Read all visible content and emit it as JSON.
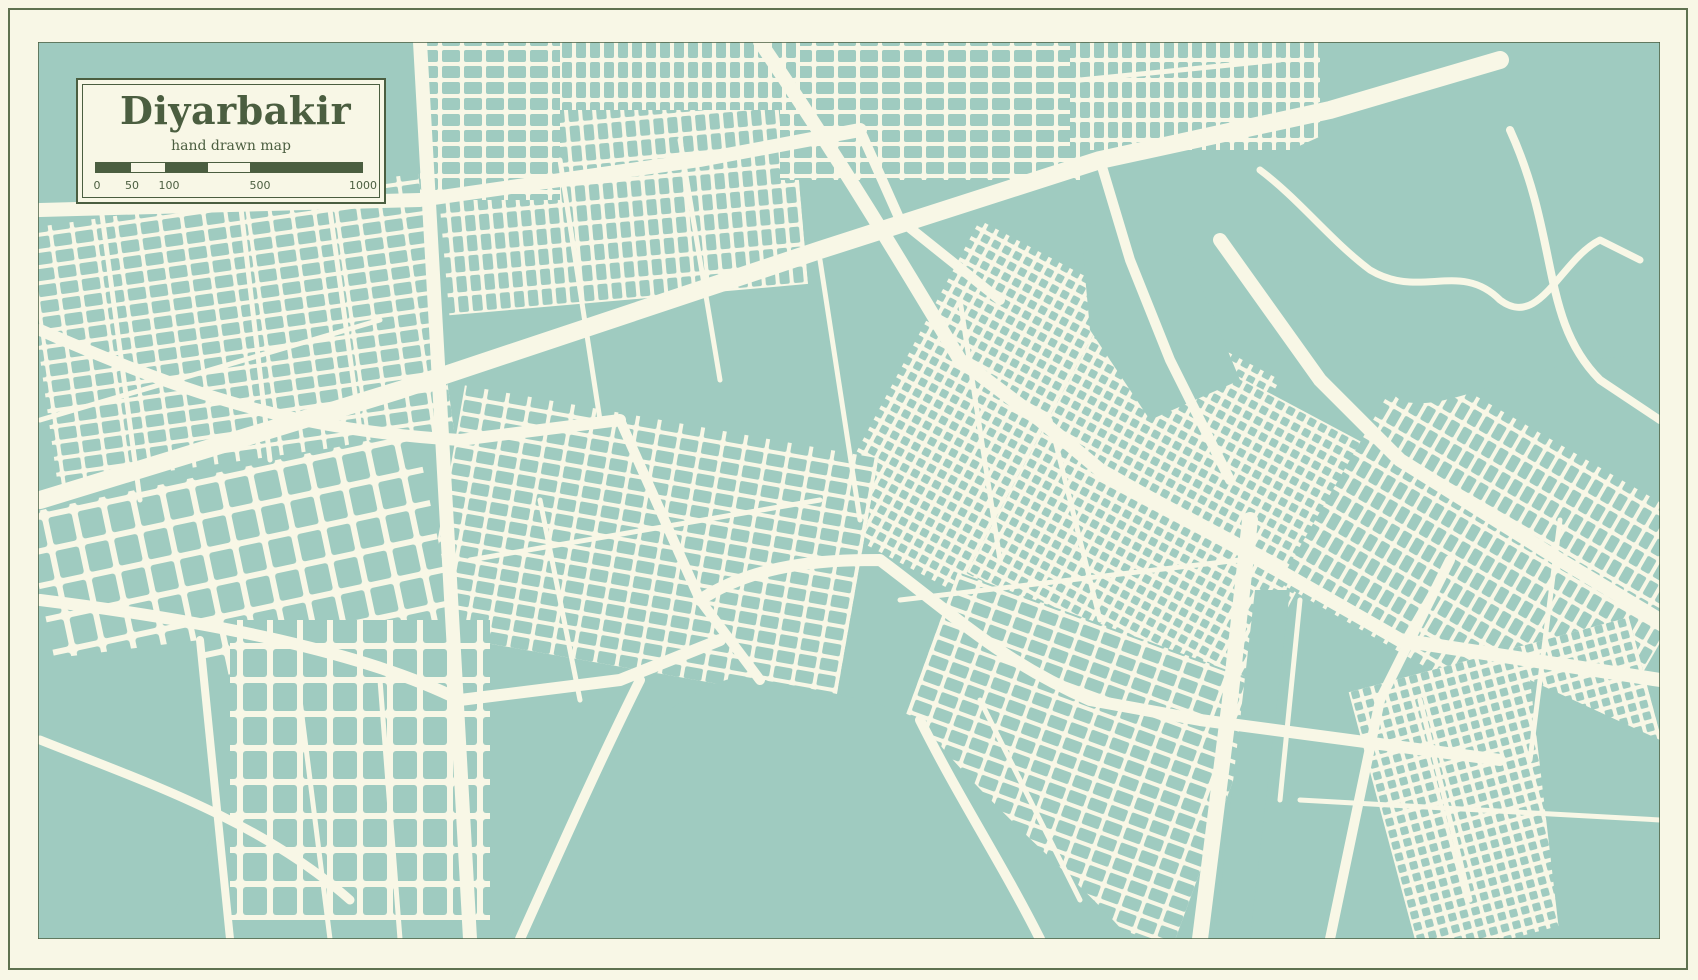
{
  "legend": {
    "title": "Diyarbakir",
    "subtitle": "hand drawn map",
    "scale_ticks": [
      "0",
      "50",
      "100",
      "500",
      "1000"
    ]
  },
  "colors": {
    "land": "#9fcbc0",
    "road": "#f8f7e6",
    "frame": "#5f7250",
    "ink": "#4b5e40"
  }
}
